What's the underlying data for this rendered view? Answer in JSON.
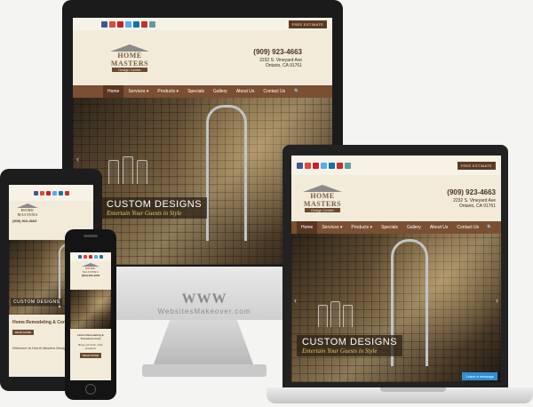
{
  "site": {
    "brand": "HOME MASTERS",
    "tagline": "Design Center",
    "phone": "(909) 923-4663",
    "address_line1": "2232 S. Vineyard Ave",
    "address_line2": "Ontario, CA 91761",
    "estimate_label": "FREE ESTIMATE",
    "nav": [
      "Home",
      "Services ▾",
      "Products ▾",
      "Specials",
      "Gallery",
      "About Us",
      "Contact Us"
    ],
    "search_icon": "🔍",
    "hero_title": "CUSTOM DESIGNS",
    "hero_subtitle": "Entertain Your Guests in Style",
    "social_colors": [
      "#3b5998",
      "#dd4b39",
      "#cb2027",
      "#55acee",
      "#0e76a8",
      "#c4302b",
      "#5f9ea0"
    ],
    "leave_message": "Leave a message"
  },
  "watermark": {
    "logo": "WWW",
    "text": "WebsitesMakeover.com"
  },
  "tablet": {
    "hero_title": "CUSTOM DESIGNS",
    "remodel_heading": "Home Remodeling & Cons",
    "welcome": "Welcome to Home Masters Design"
  },
  "phone_device": {
    "remodel_heading": "Home Remodeling & Transitions Inch",
    "remodel_sub": "Bring out fresh, write wonders!",
    "read_more": "READ MORE"
  },
  "colors": {
    "brown_nav": "#7a4f32",
    "cream": "#f2ebda",
    "gold_sub": "#e9c46a"
  }
}
